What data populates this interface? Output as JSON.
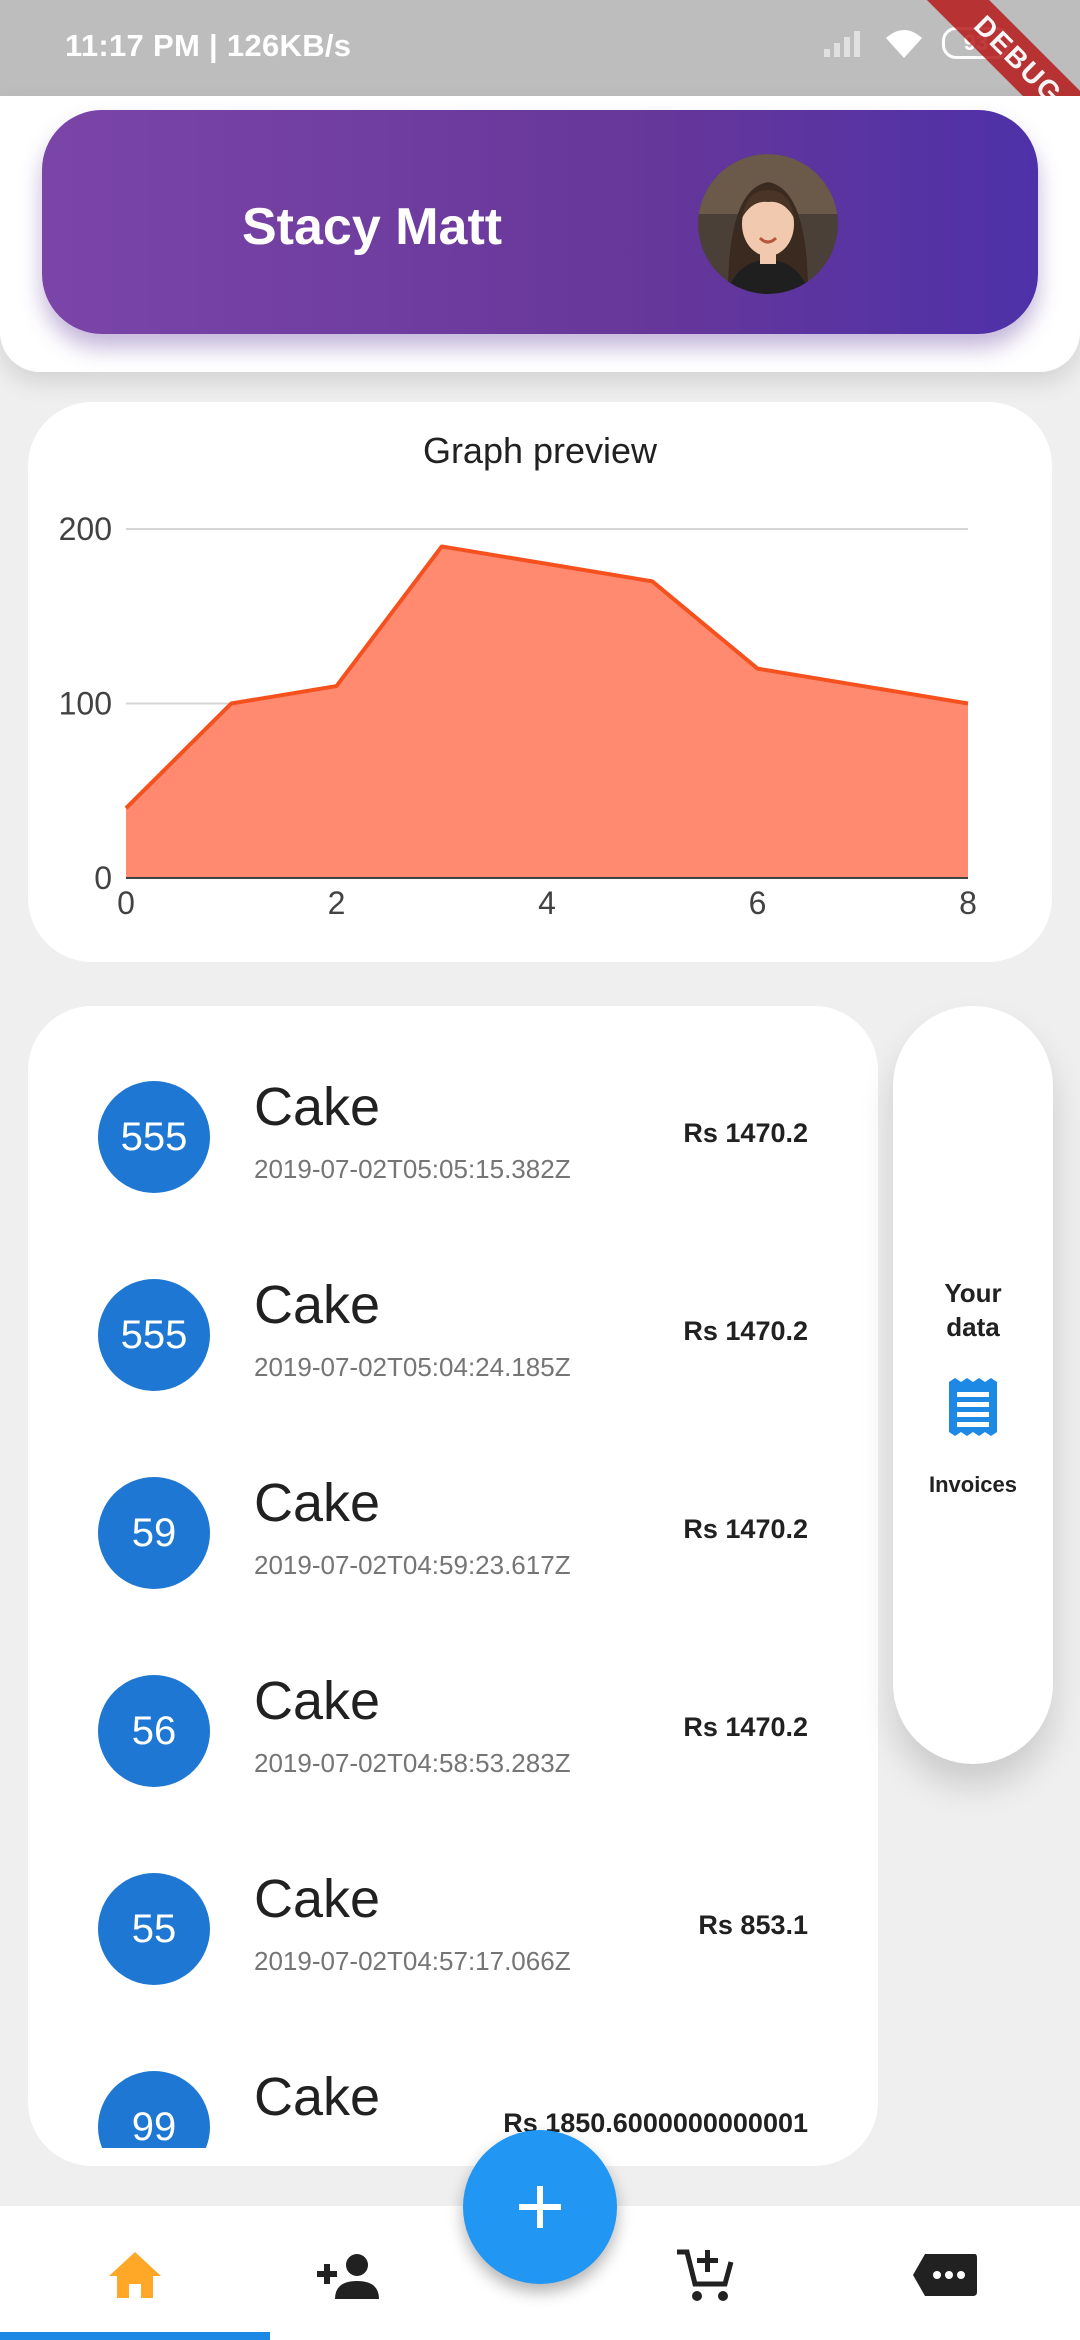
{
  "status_bar": {
    "left_text": "11:17 PM | 126KB/s",
    "battery": "93",
    "debug_banner": "DEBUG"
  },
  "profile": {
    "name": "Stacy Matt",
    "avatar_icon": "user-avatar-photo"
  },
  "graph": {
    "title": "Graph preview"
  },
  "chart_data": {
    "type": "area",
    "title": "Graph preview",
    "x": [
      0,
      1,
      2,
      3,
      4,
      5,
      6,
      7,
      8
    ],
    "series": [
      {
        "values": [
          40,
          100,
          110,
          190,
          180,
          170,
          120,
          110,
          100
        ]
      }
    ],
    "xlim": [
      0,
      8
    ],
    "ylim": [
      0,
      200
    ],
    "x_ticks": [
      0,
      2,
      4,
      6,
      8
    ],
    "y_ticks": [
      0,
      100,
      200
    ],
    "grid": true,
    "colors": {
      "fill": "#ff8a70",
      "line": "#f4511e"
    }
  },
  "list": {
    "items": [
      {
        "badge": "555",
        "title": "Cake",
        "date": "2019-07-02T05:05:15.382Z",
        "price": "Rs 1470.2"
      },
      {
        "badge": "555",
        "title": "Cake",
        "date": "2019-07-02T05:04:24.185Z",
        "price": "Rs 1470.2"
      },
      {
        "badge": "59",
        "title": "Cake",
        "date": "2019-07-02T04:59:23.617Z",
        "price": "Rs 1470.2"
      },
      {
        "badge": "56",
        "title": "Cake",
        "date": "2019-07-02T04:58:53.283Z",
        "price": "Rs 1470.2"
      },
      {
        "badge": "55",
        "title": "Cake",
        "date": "2019-07-02T04:57:17.066Z",
        "price": "Rs 853.1"
      },
      {
        "badge": "99",
        "title": "Cake",
        "date": "",
        "price": "Rs 1850.6000000000001"
      }
    ]
  },
  "side_panel": {
    "title_line1": "Your",
    "title_line2": "data",
    "icon": "receipt-icon",
    "label": "Invoices"
  },
  "bottom_nav": {
    "items": [
      {
        "icon": "home-icon",
        "active": true
      },
      {
        "icon": "person-add-icon",
        "active": false
      },
      {
        "icon": "add-cart-icon",
        "active": false
      },
      {
        "icon": "message-icon",
        "active": false
      }
    ],
    "fab_icon": "plus-icon"
  },
  "colors": {
    "accent": "#2196f3",
    "badge": "#1e77d2",
    "active_nav": "#ffa726",
    "banner_start": "#7b45a8",
    "banner_end": "#4e31a8"
  }
}
